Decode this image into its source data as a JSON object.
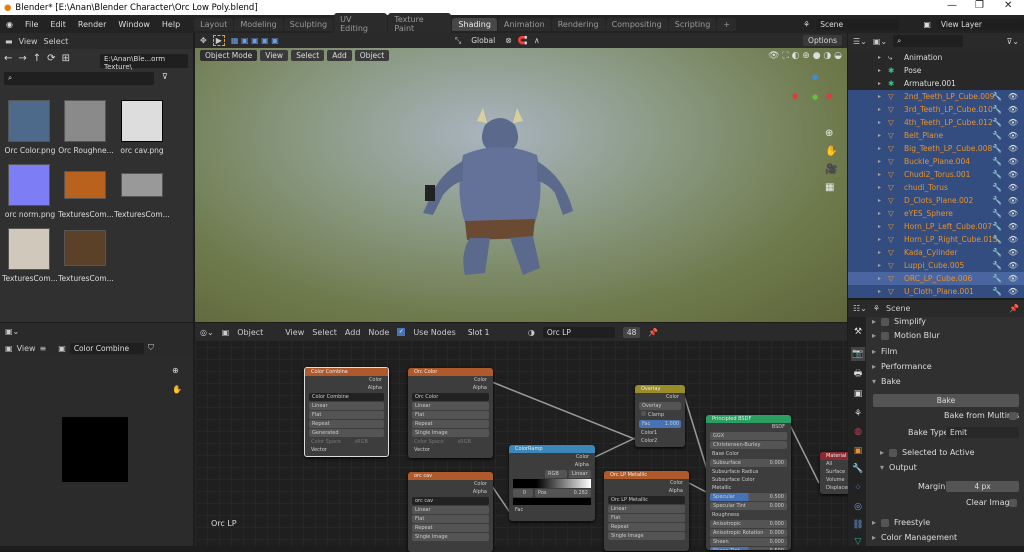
{
  "window": {
    "title": "Blender* [E:\\Anan\\Blender Character\\Orc Low Poly.blend]"
  },
  "menu": [
    "File",
    "Edit",
    "Render",
    "Window",
    "Help"
  ],
  "workspaces": [
    "Layout",
    "Modeling",
    "Sculpting",
    "UV Editing",
    "Texture Paint",
    "Shading",
    "Animation",
    "Rendering",
    "Compositing",
    "Scripting",
    "+"
  ],
  "active_workspace": "Shading",
  "scene": {
    "name": "Scene",
    "view_layer": "View Layer"
  },
  "file_browser": {
    "menu": [
      "View",
      "Select"
    ],
    "path": "E:\\Anan\\Ble...orm Texture\\",
    "files": [
      "Orc  Color.png",
      "Orc  Roughne...",
      "orc cav.png",
      "orc norm.png",
      "TexturesCom...",
      "TexturesCom...",
      "TexturesCom...",
      "TexturesCom..."
    ]
  },
  "image_editor": {
    "view": "View",
    "image": "Color Combine"
  },
  "viewport": {
    "orientation": "Global",
    "mode": "Object Mode",
    "menu": [
      "View",
      "Select",
      "Add",
      "Object"
    ],
    "options": "Options"
  },
  "node_editor": {
    "type": "Object",
    "menu": [
      "View",
      "Select",
      "Add",
      "Node"
    ],
    "use_nodes": "Use Nodes",
    "slot": "Slot 1",
    "material": "Orc LP",
    "users": "48",
    "label": "Orc LP"
  },
  "nodes": {
    "color_combine": {
      "title": "Color Combine",
      "outputs": [
        "Color",
        "Alpha"
      ],
      "image": "Color Combine",
      "rows": [
        "Linear",
        "Flat",
        "Repeat",
        "Generated"
      ],
      "cs_label": "Color Space",
      "cs_value": "sRGB",
      "input": "Vector"
    },
    "orc_color": {
      "title": "Orc  Color",
      "outputs": [
        "Color",
        "Alpha"
      ],
      "image": "Orc  Color",
      "rows": [
        "Linear",
        "Flat",
        "Repeat",
        "Single Image"
      ],
      "cs_label": "Color Space",
      "cs_value": "sRGB",
      "input": "Vector"
    },
    "orc_cav": {
      "title": "orc cav",
      "outputs": [
        "Color",
        "Alpha"
      ],
      "image": "orc cav",
      "rows": [
        "Linear",
        "Flat",
        "Repeat",
        "Single Image"
      ]
    },
    "color_ramp": {
      "title": "ColorRamp",
      "outputs": [
        "Color",
        "Alpha"
      ],
      "mode": "RGB",
      "interp": "Linear",
      "index": "0",
      "pos_label": "Pos",
      "pos": "0.282",
      "input": "Fac"
    },
    "overlay": {
      "title": "Overlay",
      "output": "Color",
      "blend": "Overlay",
      "clamp": "Clamp",
      "fac_label": "Fac",
      "fac": "1.000",
      "inputs": [
        "Color1",
        "Color2"
      ]
    },
    "metallic": {
      "title": "Orc LP Metallic",
      "outputs": [
        "Color",
        "Alpha"
      ],
      "image": "Orc LP Metallic",
      "rows": [
        "Linear",
        "Flat",
        "Repeat",
        "Single Image"
      ]
    },
    "bsdf": {
      "title": "Principled BSDF",
      "output": "BSDF",
      "rows": [
        "GGX",
        "Christensen-Burley"
      ],
      "params": [
        [
          "Base Color",
          ""
        ],
        [
          "Subsurface",
          "0.000"
        ],
        [
          "Subsurface Radius",
          ""
        ],
        [
          "Subsurface Color",
          ""
        ],
        [
          "Metallic",
          ""
        ],
        [
          "Specular",
          "0.500"
        ],
        [
          "Specular Tint",
          "0.000"
        ],
        [
          "Roughness",
          ""
        ],
        [
          "Anisotropic",
          "0.000"
        ],
        [
          "Anisotropic Rotation",
          "0.000"
        ],
        [
          "Sheen",
          "0.000"
        ],
        [
          "Sheen Tint",
          "0.500"
        ]
      ]
    },
    "output": {
      "title": "Material",
      "target": "All",
      "inputs": [
        "Surface",
        "Volume",
        "Displacement"
      ]
    }
  },
  "outliner": {
    "items": [
      {
        "name": "Animation",
        "type": "anim"
      },
      {
        "name": "Pose",
        "type": "pose"
      },
      {
        "name": "Armature.001",
        "type": "arm"
      },
      {
        "name": "2nd_Teeth_LP_Cube.009"
      },
      {
        "name": "3rd_Teeth_LP_Cube.010"
      },
      {
        "name": "4th_Teeth_LP_Cube.012"
      },
      {
        "name": "Belt_Plane"
      },
      {
        "name": "Big_Teeth_LP_Cube.008"
      },
      {
        "name": "Buckle_Plane.004"
      },
      {
        "name": "Chudi2_Torus.001"
      },
      {
        "name": "chudi_Torus"
      },
      {
        "name": "D_Clots_Plane.002"
      },
      {
        "name": "eYES_Sphere"
      },
      {
        "name": "Horn_LP_Left_Cube.007"
      },
      {
        "name": "Horn_LP_Right_Cube.013"
      },
      {
        "name": "Kada_Cylinder"
      },
      {
        "name": "Luppi_Cube.005"
      },
      {
        "name": "ORC_LP_Cube.006",
        "active": true
      },
      {
        "name": "U_Cloth_Plane.001"
      }
    ]
  },
  "properties": {
    "context": "Scene",
    "panels": {
      "simplify": "Simplify",
      "motion_blur": "Motion Blur",
      "film": "Film",
      "performance": "Performance",
      "bake": "Bake",
      "bake_button": "Bake",
      "multires": "Bake from Multires",
      "bake_type_label": "Bake Type",
      "bake_type": "Emit",
      "selected_to_active": "Selected to Active",
      "output": "Output",
      "margin_label": "Margin",
      "margin": "4 px",
      "clear_image": "Clear Image",
      "freestyle": "Freestyle",
      "color_management": "Color Management"
    }
  },
  "colors": {
    "accent": "#4772b3",
    "selected": "#334d80",
    "object_name": "#e8922e",
    "texture_node": "#b0592a",
    "mix_node": "#9a8c2a",
    "converter_node": "#3b87b9",
    "shader_node": "#2a9e63",
    "output_node": "#8c2a33"
  }
}
